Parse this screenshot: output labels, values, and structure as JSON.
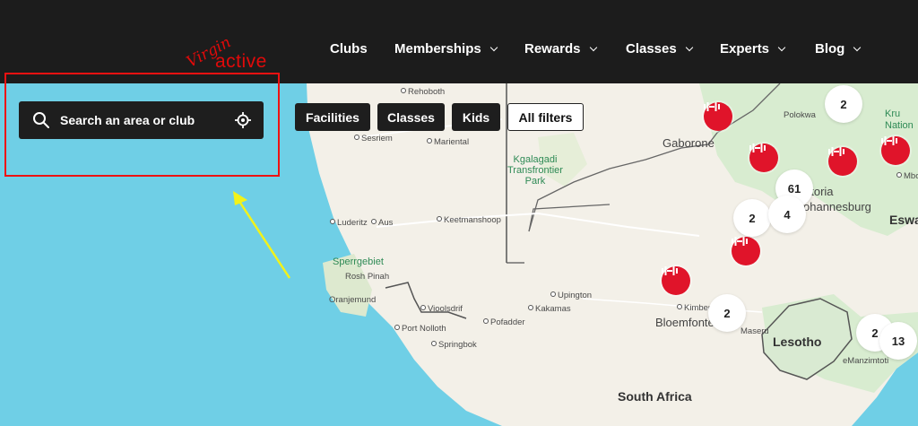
{
  "header": {
    "logo_script": "Virgin",
    "logo_word": "active",
    "nav": [
      {
        "label": "Clubs",
        "has_dropdown": false
      },
      {
        "label": "Memberships",
        "has_dropdown": true
      },
      {
        "label": "Rewards",
        "has_dropdown": true
      },
      {
        "label": "Classes",
        "has_dropdown": true
      },
      {
        "label": "Experts",
        "has_dropdown": true
      },
      {
        "label": "Blog",
        "has_dropdown": true
      }
    ]
  },
  "search": {
    "placeholder": "Search an area or club",
    "value": ""
  },
  "filters": {
    "facilities": "Facilities",
    "classes": "Classes",
    "kids": "Kids",
    "all": "All filters"
  },
  "map": {
    "places": {
      "rehoboth": "Rehoboth",
      "sesriem": "Sesriem",
      "mariental": "Mariental",
      "luderitz": "Luderitz",
      "aus": "Aus",
      "keetmanshoop": "Keetmanshoop",
      "sperrgebiet": "Sperrgebiet",
      "rosh_pinah": "Rosh Pinah",
      "oranjemund": "Oranjemund",
      "vioolsdrif": "Vioolsdrif",
      "port_nolloth": "Port Nolloth",
      "springbok": "Springbok",
      "pofadder": "Pofadder",
      "kakamas": "Kakamas",
      "upington": "Upington",
      "kgalagadi": "Kgalagadi\nTransfrontier\nPark",
      "gaborone": "Gaborone",
      "polokwane": "Polokwa",
      "pretoria": "etoria",
      "johannesburg": "ohannesburg",
      "kimberley": "Kimberl",
      "bloemfontein": "Bloemfonte",
      "maseru": "Maseru",
      "lesotho": "Lesotho",
      "south_africa": "South Africa",
      "eswatini": "Eswa",
      "kruger": "Kru\nNation",
      "mbombela": "Mbo",
      "emanzimtoti": "eManzimtoti"
    },
    "clusters": [
      "2",
      "61",
      "2",
      "4",
      "2",
      "2",
      "13"
    ]
  },
  "colors": {
    "header_bg": "#1c1c1c",
    "brand_red": "#e10a0a",
    "pin_red": "#e0142a",
    "ocean": "#6fcfe6",
    "land": "#f3f0e8",
    "annotation_box": "#ee1111",
    "annotation_arrow": "#f2f21a"
  }
}
